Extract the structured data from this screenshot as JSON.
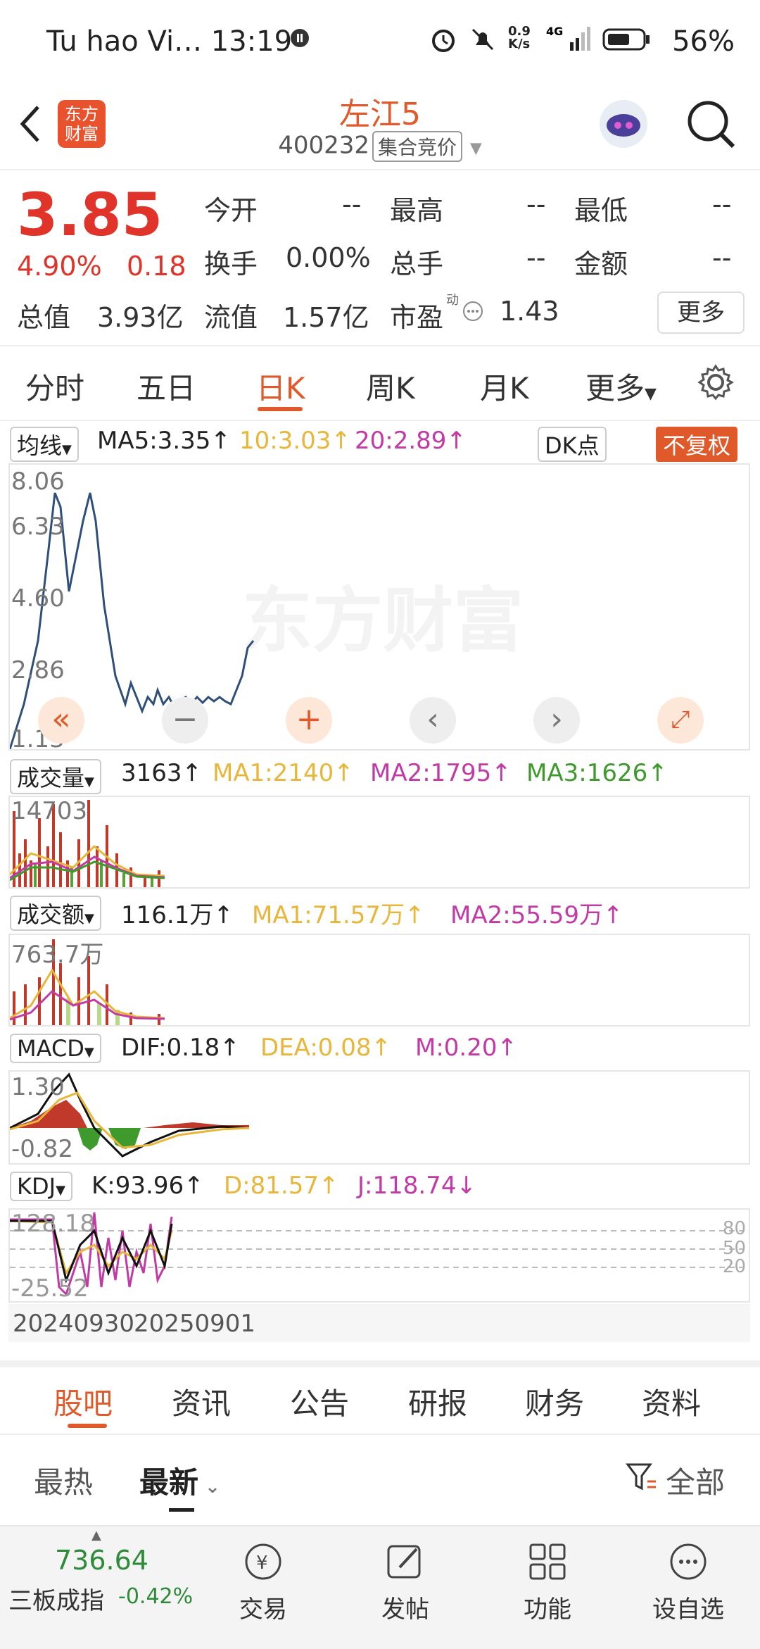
{
  "status_bar": {
    "carrier": "Tu hao Vi… 13:19",
    "speed": "0.9\nK/s",
    "battery": "56%"
  },
  "header": {
    "title": "左江5",
    "code": "400232",
    "tag": "集合竞价",
    "logo_text": "东方\n财富"
  },
  "quote": {
    "price": "3.85",
    "change_pct": "4.90%",
    "change": "0.18",
    "open_label": "今开",
    "open_val": "--",
    "high_label": "最高",
    "high_val": "--",
    "low_label": "最低",
    "low_val": "--",
    "turnover_label": "换手",
    "turnover_val": "0.00%",
    "total_hand_label": "总手",
    "total_hand_val": "--",
    "amount_label": "金额",
    "amount_val": "--",
    "mktcap_label": "总值",
    "mktcap_val": "3.93亿",
    "float_label": "流值",
    "float_val": "1.57亿",
    "pe_label": "市盈",
    "pe_sup": "动",
    "pe_val": "1.43",
    "more": "更多"
  },
  "tabs": [
    "分时",
    "五日",
    "日K",
    "周K",
    "月K",
    "更多"
  ],
  "ma_row": {
    "selector": "均线",
    "ma5": "MA5:3.35↑",
    "ma10": "10:3.03↑",
    "ma20": "20:2.89↑",
    "dk": "DK点",
    "fq": "不复权"
  },
  "price_axis": [
    "8.06",
    "6.33",
    "4.60",
    "2.86",
    "1.13"
  ],
  "watermark": "东方财富",
  "vol_row": {
    "selector": "成交量",
    "v": "3163↑",
    "ma1": "MA1:2140↑",
    "ma2": "MA2:1795↑",
    "ma3": "MA3:1626↑",
    "axis_top": "14703"
  },
  "amt_row": {
    "selector": "成交额",
    "v": "116.1万↑",
    "ma1": "MA1:71.57万↑",
    "ma2": "MA2:55.59万↑",
    "axis_top": "763.7万"
  },
  "macd_row": {
    "selector": "MACD",
    "dif": "DIF:0.18↑",
    "dea": "DEA:0.08↑",
    "m": "M:0.20↑",
    "axis_top": "1.30",
    "axis_bottom": "-0.82"
  },
  "kdj_row": {
    "selector": "KDJ",
    "k": "K:93.96↑",
    "d": "D:81.57↑",
    "j": "J:118.74↓",
    "axis_top": "128.18",
    "axis_bottom": "-25.52",
    "levels": [
      "80",
      "50",
      "20"
    ]
  },
  "date_axis": {
    "start": "20240930",
    "end": "20250901"
  },
  "colors": {
    "accent": "#e0592a",
    "up": "#e0332a",
    "ma10": "#e8b63a",
    "ma20": "#c23aa6",
    "ma3": "#3f9a2e"
  },
  "news_tabs": [
    "股吧",
    "资讯",
    "公告",
    "研报",
    "财务",
    "资料"
  ],
  "sort": {
    "hot": "最热",
    "latest": "最新",
    "filter": "全部"
  },
  "bottom_nav": {
    "index_value": "736.64",
    "index_name": "三板成指",
    "index_change": "-0.42%",
    "items": [
      "交易",
      "发帖",
      "功能",
      "设自选"
    ]
  }
}
